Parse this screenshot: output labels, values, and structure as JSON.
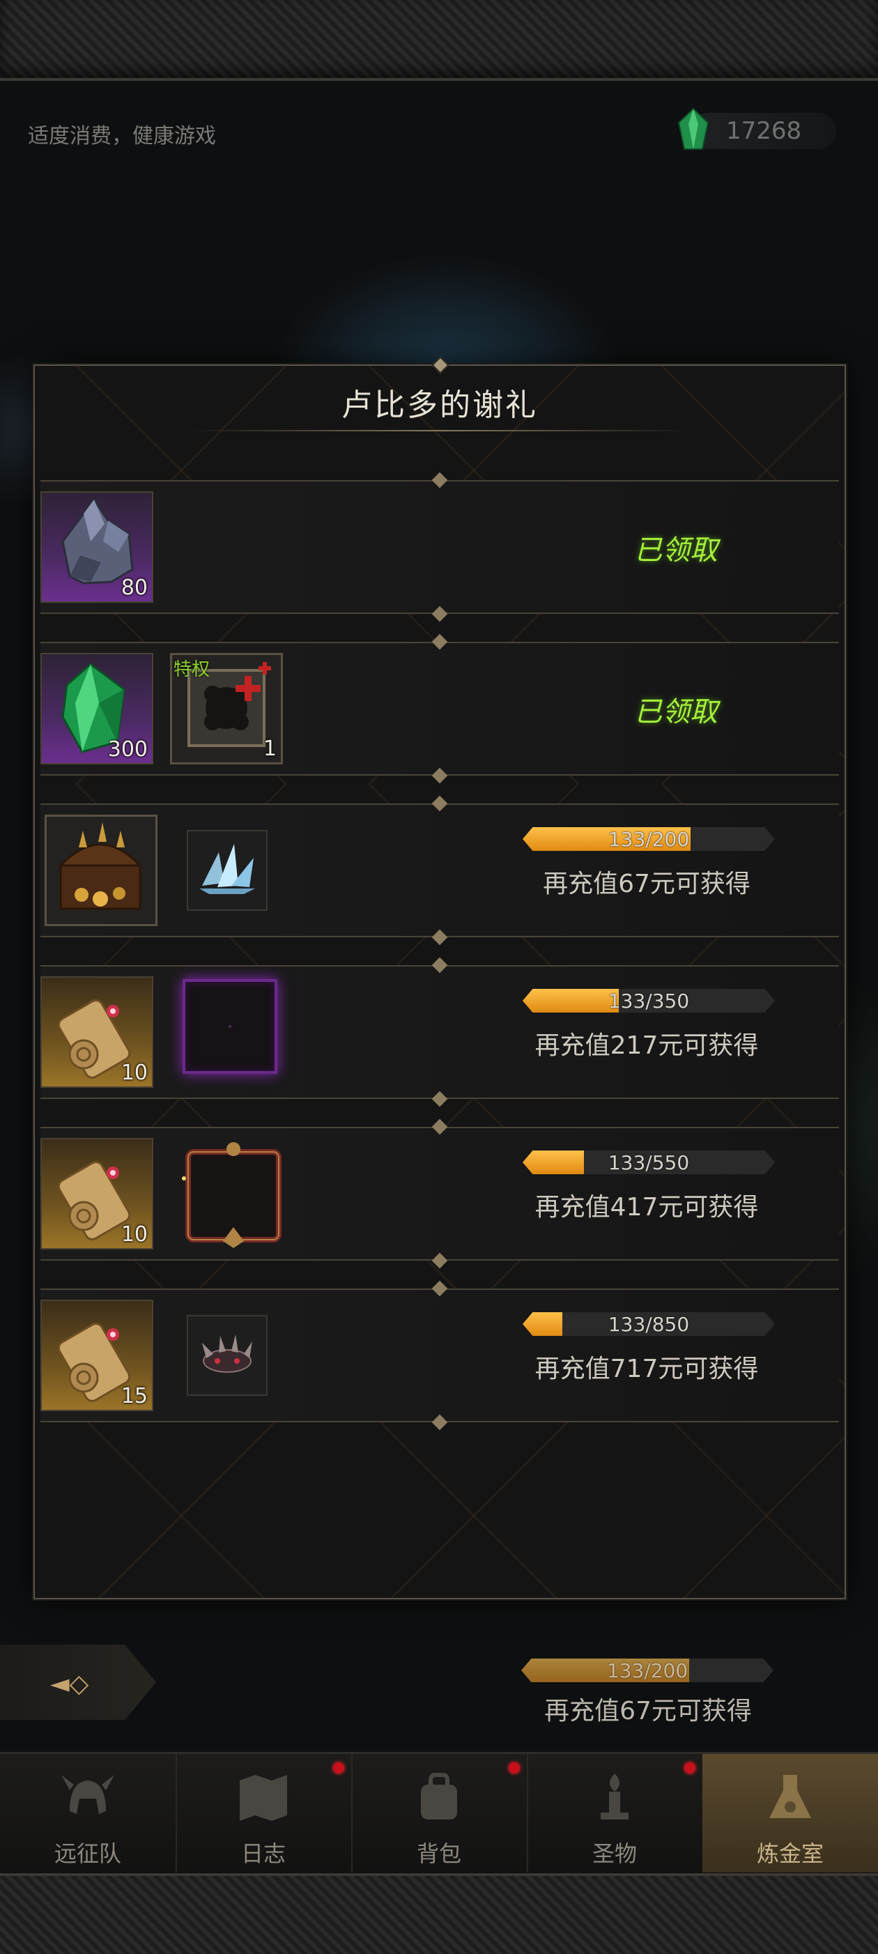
{
  "header": {
    "moderation_note": "适度消费，健康游戏",
    "currency_value": "17268",
    "currency_icon": "green-gem-icon"
  },
  "modal": {
    "title": "卢比多的谢礼",
    "rows": [
      {
        "items": [
          {
            "icon": "ore-icon",
            "quantity": "80",
            "rarity": "purple"
          }
        ],
        "status": "已领取"
      },
      {
        "items": [
          {
            "icon": "green-gem-icon",
            "quantity": "300",
            "rarity": "purple"
          },
          {
            "icon": "privilege-card-icon",
            "quantity": "1",
            "badge": "特权"
          }
        ],
        "status": "已领取"
      },
      {
        "items": [
          {
            "icon": "treasure-chest-icon"
          },
          {
            "icon": "ice-crystal-icon"
          }
        ],
        "progress": {
          "current": 133,
          "total": 200,
          "label": "133/200"
        },
        "requirement": "再充值67元可获得"
      },
      {
        "items": [
          {
            "icon": "scroll-icon",
            "quantity": "10",
            "rarity": "gold"
          },
          {
            "icon": "purple-frame-icon"
          }
        ],
        "progress": {
          "current": 133,
          "total": 350,
          "label": "133/350"
        },
        "requirement": "再充值217元可获得"
      },
      {
        "items": [
          {
            "icon": "scroll-icon",
            "quantity": "10",
            "rarity": "gold"
          },
          {
            "icon": "crimson-frame-icon"
          }
        ],
        "progress": {
          "current": 133,
          "total": 550,
          "label": "133/550"
        },
        "requirement": "再充值417元可获得"
      },
      {
        "items": [
          {
            "icon": "scroll-icon",
            "quantity": "15",
            "rarity": "gold"
          },
          {
            "icon": "spiked-crown-icon"
          }
        ],
        "progress": {
          "current": 133,
          "total": 850,
          "label": "133/850"
        },
        "requirement": "再充值717元可获得"
      }
    ]
  },
  "background": {
    "progress": {
      "current": 133,
      "total": 200,
      "label": "133/200"
    },
    "requirement": "再充值67元可获得"
  },
  "nav": {
    "items": [
      {
        "label": "远征队",
        "icon": "helmet-icon",
        "active": false,
        "dot": false
      },
      {
        "label": "日志",
        "icon": "map-icon",
        "active": false,
        "dot": true
      },
      {
        "label": "背包",
        "icon": "backpack-icon",
        "active": false,
        "dot": true
      },
      {
        "label": "圣物",
        "icon": "relic-icon",
        "active": false,
        "dot": true
      },
      {
        "label": "炼金室",
        "icon": "alchemy-icon",
        "active": true,
        "dot": false
      }
    ]
  },
  "colors": {
    "claimed": "#a6f03a",
    "progress_fill": "#f0a21e",
    "notification_dot": "#c8101a"
  }
}
